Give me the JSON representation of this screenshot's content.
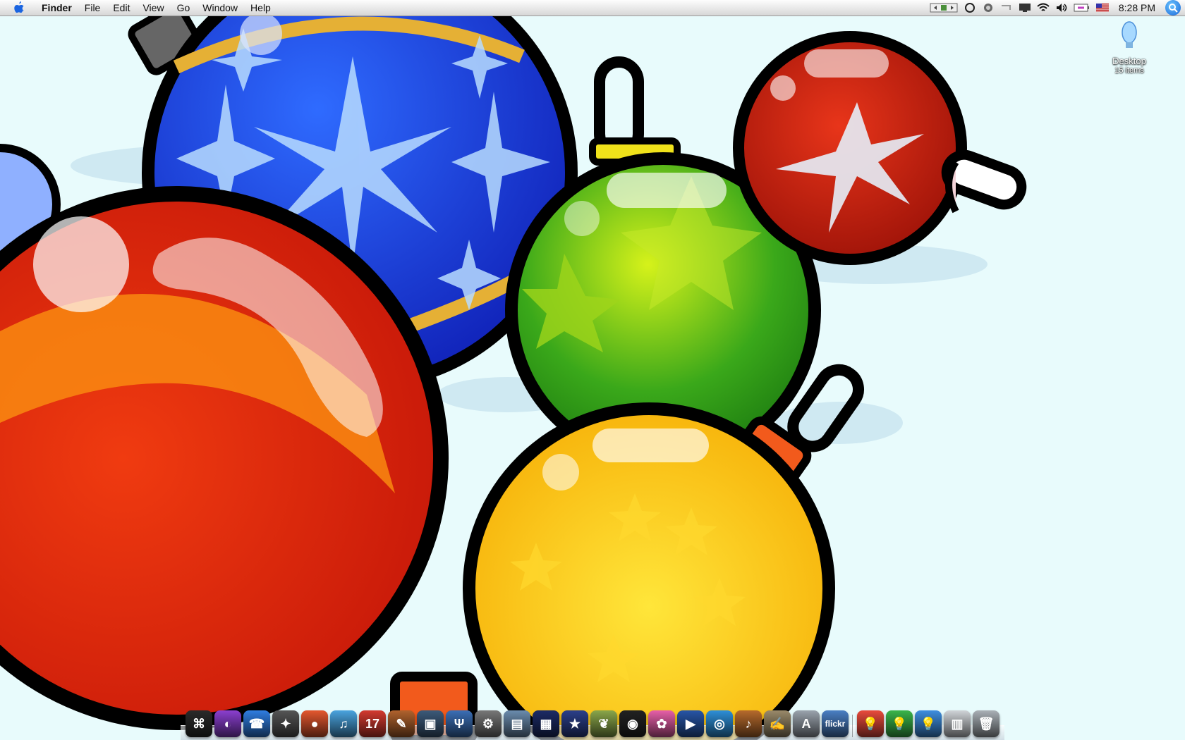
{
  "menubar": {
    "apple_icon": "apple-logo-icon",
    "app_name": "Finder",
    "items": [
      "File",
      "Edit",
      "View",
      "Go",
      "Window",
      "Help"
    ],
    "status_icons": [
      "spaces-icon",
      "sync-circle-icon",
      "time-machine-icon",
      "display-icon",
      "screen-icon",
      "wifi-icon",
      "volume-icon",
      "battery-icon",
      "us-flag-icon"
    ],
    "clock": "8:28 PM",
    "spotlight_icon": "spotlight-icon"
  },
  "desktop": {
    "icon_name": "Desktop",
    "icon_sub": "15 items"
  },
  "dock": {
    "items": [
      {
        "name": "finder-icon",
        "color": "#2a2a2a",
        "glyph": "⌘"
      },
      {
        "name": "front-row-icon",
        "color": "#8b3fd0",
        "glyph": "◐"
      },
      {
        "name": "ichat-icon",
        "color": "#2f7de1",
        "glyph": "☎"
      },
      {
        "name": "safari-icon",
        "color": "#555555",
        "glyph": "✦"
      },
      {
        "name": "fruit-app-icon",
        "color": "#e4572e",
        "glyph": "●"
      },
      {
        "name": "itunes-icon",
        "color": "#4aa3df",
        "glyph": "♫"
      },
      {
        "name": "ical-icon",
        "color": "#d33a2f",
        "glyph": "17"
      },
      {
        "name": "brush-icon",
        "color": "#b0622d",
        "glyph": "✎"
      },
      {
        "name": "preview-icon",
        "color": "#3c5a7a",
        "glyph": "▣"
      },
      {
        "name": "tuxedo-icon",
        "color": "#3b6fb6",
        "glyph": "Ψ"
      },
      {
        "name": "system-tool-icon",
        "color": "#777777",
        "glyph": "⚙"
      },
      {
        "name": "iphoto-icon",
        "color": "#6b8cae",
        "glyph": "▤"
      },
      {
        "name": "stage-icon",
        "color": "#1c2b66",
        "glyph": "▦"
      },
      {
        "name": "star-app-icon",
        "color": "#2b3f8a",
        "glyph": "★"
      },
      {
        "name": "feather-icon",
        "color": "#8aa64a",
        "glyph": "❦"
      },
      {
        "name": "camera-icon",
        "color": "#222222",
        "glyph": "◉"
      },
      {
        "name": "flower-icon",
        "color": "#e75fa8",
        "glyph": "✿"
      },
      {
        "name": "imovie-icon",
        "color": "#2755a6",
        "glyph": "▶"
      },
      {
        "name": "idvd-icon",
        "color": "#2e8fd8",
        "glyph": "◎"
      },
      {
        "name": "garageband-icon",
        "color": "#b66a2c",
        "glyph": "♪"
      },
      {
        "name": "textedit-icon",
        "color": "#9a8a6a",
        "glyph": "✍"
      },
      {
        "name": "app-store-icon",
        "color": "#9aa3ad",
        "glyph": "A"
      },
      {
        "name": "flickr-upload-icon",
        "color": "#4a7fc4",
        "glyph": "flickr"
      }
    ],
    "right_items": [
      {
        "name": "red-bulb-icon",
        "color": "#e94b3c",
        "glyph": "💡"
      },
      {
        "name": "green-bulb-icon",
        "color": "#3ab54a",
        "glyph": "💡"
      },
      {
        "name": "blue-bulb-icon",
        "color": "#3e8ee0",
        "glyph": "💡"
      },
      {
        "name": "document-stack-icon",
        "color": "#d0d4d8",
        "glyph": "▥"
      },
      {
        "name": "trash-icon",
        "color": "#a9b0b6",
        "glyph": "🗑"
      }
    ]
  }
}
